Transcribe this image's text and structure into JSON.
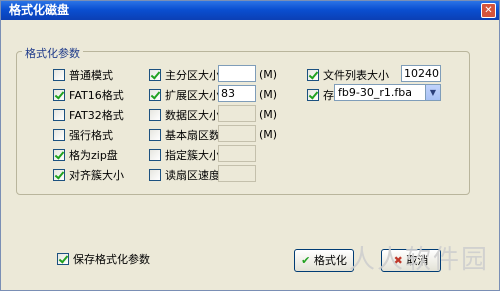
{
  "window": {
    "title": "格式化磁盘",
    "close_glyph": "✕"
  },
  "group": {
    "title": "格式化参数"
  },
  "options": {
    "normal_mode": {
      "label": "普通模式",
      "checked": false
    },
    "fat16": {
      "label": "FAT16格式",
      "checked": true
    },
    "fat32": {
      "label": "FAT32格式",
      "checked": false
    },
    "force_format": {
      "label": "强行格式",
      "checked": false
    },
    "zip_disk": {
      "label": "格为zip盘",
      "checked": true
    },
    "align_cluster": {
      "label": "对齐簇大小",
      "checked": true
    }
  },
  "params": {
    "primary_partition": {
      "label": "主分区大小",
      "checked": true,
      "value": "",
      "unit": "(M)"
    },
    "extended_partition": {
      "label": "扩展区大小",
      "checked": true,
      "value": "83",
      "unit": "(M)"
    },
    "data_area": {
      "label": "数据区大小",
      "checked": false,
      "value": "",
      "unit": "(M)"
    },
    "base_sector": {
      "label": "基本扇区数",
      "checked": false,
      "value": "",
      "unit": "(M)"
    },
    "cluster_size": {
      "label": "指定簇大小",
      "checked": false,
      "value": ""
    },
    "read_speed": {
      "label": "读扇区速度",
      "checked": false,
      "value": ""
    }
  },
  "right": {
    "file_list_size": {
      "label": "文件列表大小",
      "checked": true,
      "value": "10240"
    },
    "archive_file": {
      "label": "存档文件",
      "checked": true,
      "selected": "fb9-30_r1.fba"
    }
  },
  "footer": {
    "save_params": {
      "label": "保存格式化参数",
      "checked": true
    },
    "format_button": "格式化",
    "cancel_button": "取消"
  },
  "watermark": "人人软件园"
}
